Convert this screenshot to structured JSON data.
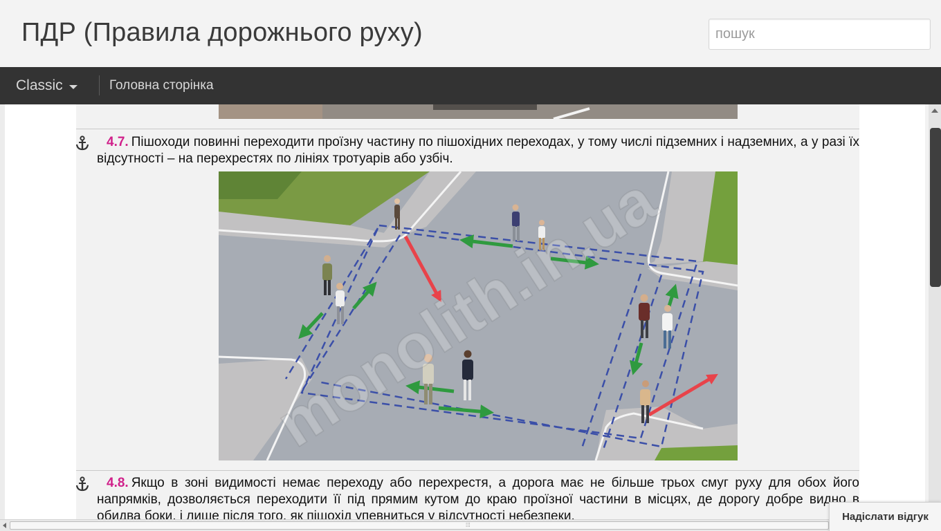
{
  "header": {
    "site_title": "ПДР (Правила дорожнього руху)",
    "search_placeholder": "пошук"
  },
  "navbar": {
    "classic_label": "Classic",
    "home_label": "Головна сторінка"
  },
  "rules": [
    {
      "number": "4.7.",
      "text": "Пішоходи повинні переходити проїзну частину по пішохідних переходах, у тому числі підземних і надземних, а у разі їх відсутності – на перехрестях по лініях тротуарів або узбіч."
    },
    {
      "number": "4.8.",
      "text": "Якщо в зоні видимості немає переходу або перехрестя, а дорога має не більше трьох смуг руху для обох його напрямків, дозволяється переходити її під прямим кутом до краю проїзної частини в місцях, де дорогу добре видно в обидва боки, і лише після того, як пішохід упевниться у відсутності небезпеки."
    }
  ],
  "illustration": {
    "watermark": "monolith.in.ua"
  },
  "feedback": {
    "label": "Надіслати відгук"
  },
  "colors": {
    "rule_number": "#d0208a",
    "navbar_bg": "#333333",
    "arrow_green": "#2f9a3f",
    "arrow_red": "#e8434a",
    "crosswalk_blue": "#3b4fa8"
  }
}
